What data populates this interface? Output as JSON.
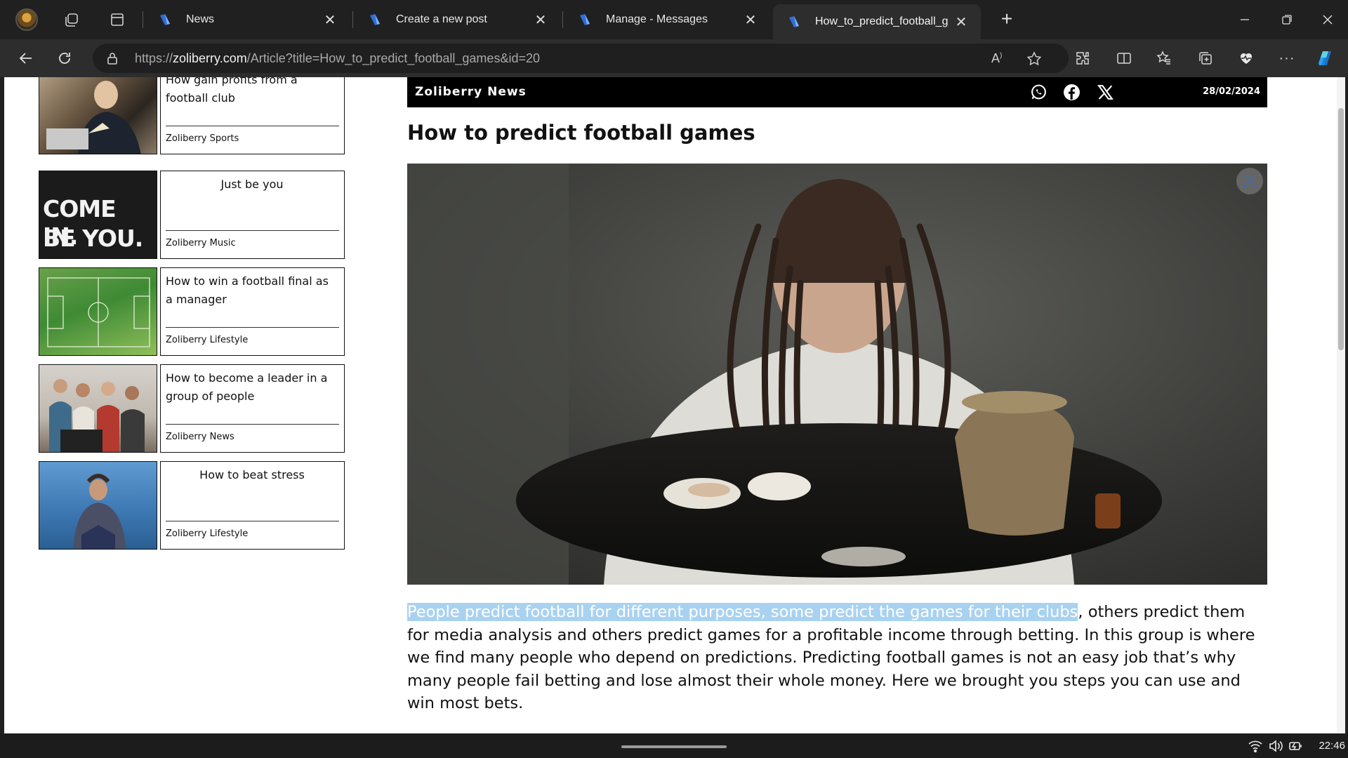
{
  "tabs": [
    {
      "title": "News",
      "active": false
    },
    {
      "title": "Create a new post",
      "active": false
    },
    {
      "title": "Manage - Messages",
      "active": false
    },
    {
      "title": "How_to_predict_football_g",
      "active": true
    }
  ],
  "address_bar": {
    "url_prefix": "https://",
    "url_host": "zoliberry.com",
    "url_path": "/Article?title=How_to_predict_football_games&id=20"
  },
  "sidebar": {
    "cards": [
      {
        "title": "How gain profits from a football club",
        "source": "Zoliberry Sports",
        "center": false
      },
      {
        "title": "Just be you",
        "source": "Zoliberry Music",
        "center": true,
        "thumb_text_1": "COME IN.",
        "thumb_text_2": "BE YOU."
      },
      {
        "title": "How to win a football final as a manager",
        "source": "Zoliberry Lifestyle",
        "center": false
      },
      {
        "title": "How to become a leader in a group of people",
        "source": "Zoliberry News",
        "center": false
      },
      {
        "title": "How to beat stress",
        "source": "Zoliberry Lifestyle",
        "center": true
      }
    ]
  },
  "article": {
    "brand": "Zoliberry News",
    "date": "28/02/2024",
    "headline": "How to predict football games",
    "para_selected": "People predict football for different purposes, some predict the games for their clubs",
    "para_rest": ", others predict them for media analysis and others predict games for a profitable income through betting. In this group is where we find many people who depend on predictions. Predicting football games is not an easy job that’s why many people fail betting and lose almost their whole money. Here we brought you steps you can use and win most bets."
  },
  "taskbar": {
    "time": "22:46"
  },
  "colors": {
    "accent_selection": "#a9d2f0",
    "favicon": "#2f6fd6"
  }
}
